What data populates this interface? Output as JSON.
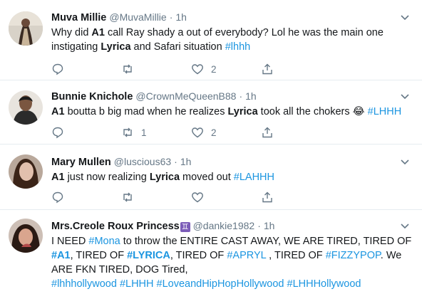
{
  "tweets": [
    {
      "name": "Muva Millie",
      "handle": "@MuvaMillie",
      "time": "1h",
      "text_a": "Why did ",
      "bold_1": "A1",
      "text_b": " call Ray shady a",
      "text_c": " out of everybody? Lol he was the main one instigating ",
      "bold_2": "Lyrica",
      "text_d": " and Safari situation ",
      "tag_1": "#lhhh",
      "reply_count": "",
      "retweet_count": "",
      "like_count": "2"
    },
    {
      "name": "Bunnie Knichole",
      "handle": "@CrownMeQueenB88",
      "time": "1h",
      "bold_1": "A1",
      "text_a": " boutta b big mad when he realizes ",
      "bold_2": "Lyrica",
      "text_b": " took all the chokers ",
      "emoji": "😂",
      "tag_1": "#LHHH",
      "reply_count": "",
      "retweet_count": "1",
      "like_count": "2"
    },
    {
      "name": "Mary Mullen",
      "handle": "@luscious63",
      "time": "1h",
      "bold_1": "A1",
      "text_a": " just now realizing ",
      "bold_2": "Lyrica",
      "text_b": " moved out ",
      "tag_1": "#LAHHH",
      "reply_count": "",
      "retweet_count": "",
      "like_count": ""
    },
    {
      "name": "Mrs.Creole Roux Princess",
      "name_symbol": "♊",
      "handle": "@dankie1982",
      "time": "1h",
      "text_a": "I NEED ",
      "tag_1": "#Mona",
      "text_b": " to throw the ENTIRE CAST AWAY, WE ARE TIRED, TIRED OF ",
      "tag_2": "#A1",
      "text_c": ", TIRED OF ",
      "tag_3": "#LYRICA",
      "text_d": ", TIRED OF ",
      "tag_4": "#APRYL",
      "text_e": " , TIRED OF ",
      "tag_5": "#FIZZYPOP",
      "text_f": ". We ARE FKN TIRED, DOG Tired,",
      "tag_6": "#lhhhollywood",
      "tag_7": "#LHHH",
      "tag_8": "#LoveandHipHopHollywood",
      "tag_9": "#LHHHollywood"
    }
  ],
  "separator_dot": "·",
  "icons": [
    "reply-icon",
    "retweet-icon",
    "like-icon",
    "share-icon",
    "chevron-down-icon"
  ],
  "colors": {
    "link": "#1b95e0",
    "muted": "#657786",
    "border": "#e6ecf0"
  }
}
